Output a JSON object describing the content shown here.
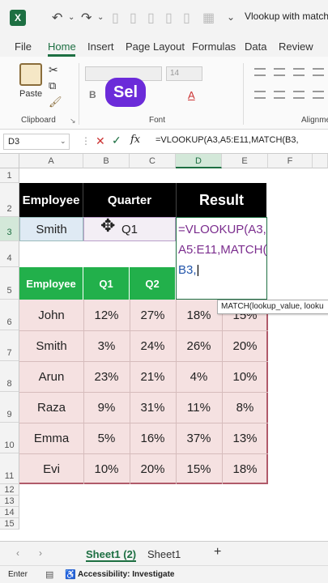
{
  "app": {
    "title": "Vlookup with match f",
    "icons": [
      "excel-logo",
      "undo-icon",
      "redo-icon",
      "save-icon"
    ]
  },
  "tabs": [
    "File",
    "Home",
    "Insert",
    "Page Layout",
    "Formulas",
    "Data",
    "Review"
  ],
  "ribbon": {
    "paste_label": "Paste",
    "clipboard_label": "Clipboard",
    "font_label": "Font",
    "alignment_label": "Alignme",
    "font_size": "14",
    "bold_label": "B",
    "overlay_logo": "Sel"
  },
  "formula_bar": {
    "name_box": "D3",
    "fx": "fx",
    "formula": "=VLOOKUP(A3,A5:E11,MATCH(B3,"
  },
  "columns": [
    "A",
    "B",
    "C",
    "D",
    "E",
    "F"
  ],
  "rows": [
    "1",
    "2",
    "3",
    "4",
    "5",
    "6",
    "7",
    "8",
    "9",
    "10",
    "11",
    "12",
    "13",
    "14",
    "15"
  ],
  "sheet": {
    "header_employee": "Employee",
    "header_quarter": "Quarter",
    "header_result": "Result",
    "input_employee": "Smith",
    "input_quarter": "Q1",
    "edit_line1": "=VLOOKUP(A3,",
    "edit_line2": "A5:E11,MATCH(",
    "edit_line3": "B3,",
    "tooltip": "MATCH(lookup_value, looku",
    "table_headers": [
      "Employee",
      "Q1",
      "Q2"
    ],
    "table_rows": [
      [
        "John",
        "12%",
        "27%",
        "18%",
        "15%"
      ],
      [
        "Smith",
        "3%",
        "24%",
        "26%",
        "20%"
      ],
      [
        "Arun",
        "23%",
        "21%",
        "4%",
        "10%"
      ],
      [
        "Raza",
        "9%",
        "31%",
        "11%",
        "8%"
      ],
      [
        "Emma",
        "5%",
        "16%",
        "37%",
        "13%"
      ],
      [
        "Evi",
        "10%",
        "20%",
        "15%",
        "18%"
      ]
    ]
  },
  "sheet_tabs": [
    "Sheet1 (2)",
    "Sheet1"
  ],
  "status": {
    "mode": "Enter",
    "accessibility": "Accessibility: Investigate"
  },
  "colors": {
    "excel_green": "#1d6f42",
    "header_green": "#22b04b",
    "data_pink": "#f5e1e1",
    "logo_purple": "#6b2bd9"
  }
}
